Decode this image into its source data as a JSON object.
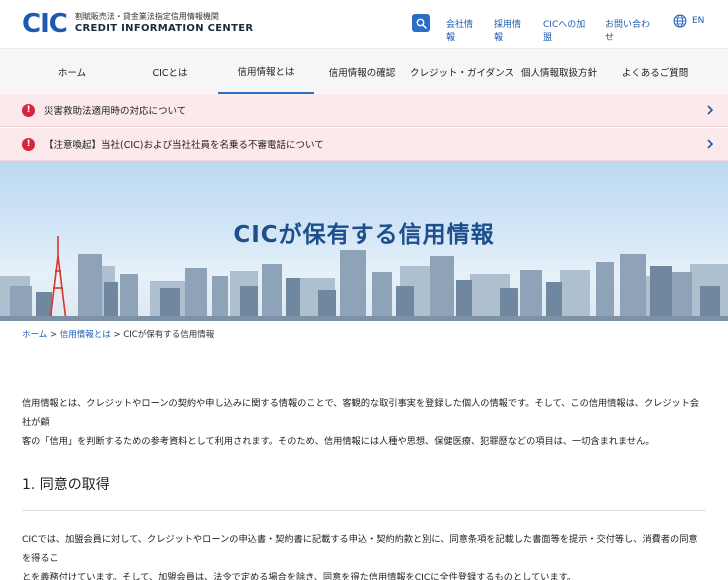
{
  "header": {
    "logo_mark": "CIC",
    "logo_sub": "割賦販売法・貸金業法指定信用情報機関",
    "logo_main": "CREDIT INFORMATION CENTER",
    "util_links": [
      "会社情報",
      "採用情報",
      "CICへの加盟",
      "お問い合わせ"
    ],
    "lang_label": "EN",
    "search_icon": "search-icon",
    "globe_icon": "globe-icon",
    "accent_color": "#2a6fc4"
  },
  "nav": {
    "items": [
      "ホーム",
      "CICとは",
      "信用情報とは",
      "信用情報の確認",
      "クレジット・ガイダンス",
      "個人情報取扱方針",
      "よくあるご質問"
    ],
    "active_index": 2
  },
  "notices": [
    {
      "text": "災害救助法適用時の対応について",
      "icon": "alert-icon"
    },
    {
      "text": "【注意喚起】当社(CIC)および当社社員を名乗る不審電話について",
      "icon": "alert-icon"
    }
  ],
  "hero": {
    "title": "CICが保有する信用情報"
  },
  "breadcrumb": {
    "home": "ホーム",
    "sep1": ">",
    "parent": "信用情報とは",
    "sep2": ">",
    "current": "CICが保有する信用情報"
  },
  "content": {
    "intro_line1": "信用情報とは、クレジットやローンの契約や申し込みに関する情報のことで、客観的な取引事実を登録した個人の情報です。そして、この信用情報は、クレジット会社が顧",
    "intro_line2": "客の「信用」を判断するための参考資料として利用されます。そのため、信用情報には人種や思想、保健医療、犯罪歴などの項目は、一切含まれません。",
    "section1_title": "1. 同意の取得",
    "para2_line1": "CICでは、加盟会員に対して、クレジットやローンの申込書・契約書に記載する申込・契約約款と別に、同意条項を記載した書面等を提示・交付等し、消費者の同意を得るこ",
    "para2_line2": "とを義務付けています。そして、加盟会員は、法令で定める場合を除き、同意を得た信用情報をCICに全件登録するものとしています。"
  }
}
